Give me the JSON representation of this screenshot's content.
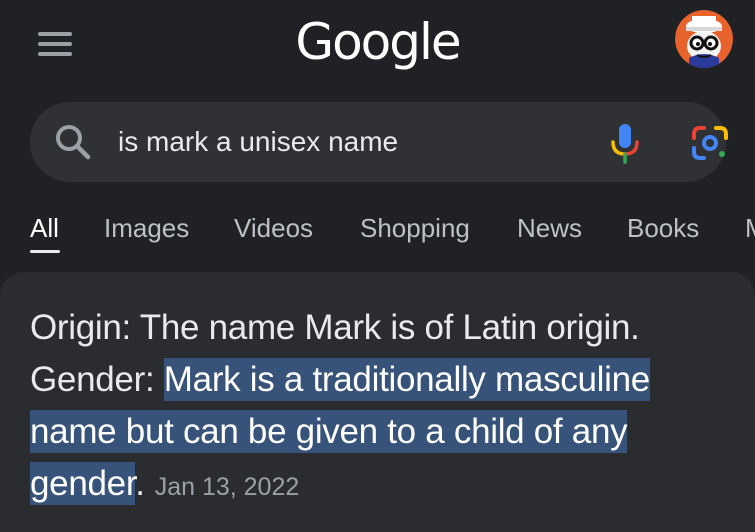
{
  "header": {
    "menu_icon": "hamburger-menu-icon",
    "logo_text": "Google",
    "avatar_icon": "profile-avatar-icon"
  },
  "search": {
    "query": "is mark a unisex name",
    "search_icon": "search-icon",
    "mic_icon": "microphone-icon",
    "lens_icon": "google-lens-icon",
    "colors": {
      "mic_blue": "#4285f4",
      "mic_red": "#ea4335",
      "mic_yellow": "#fbbc04",
      "mic_green": "#34a853"
    }
  },
  "tabs": [
    {
      "label": "All",
      "active": true
    },
    {
      "label": "Images",
      "active": false
    },
    {
      "label": "Videos",
      "active": false
    },
    {
      "label": "Shopping",
      "active": false
    },
    {
      "label": "News",
      "active": false
    },
    {
      "label": "Books",
      "active": false
    },
    {
      "label": "M",
      "active": false
    }
  ],
  "result": {
    "origin_text": "Origin: The name Mark is of Latin origin.",
    "gender_prefix": "Gender: ",
    "highlight_text": "Mark is a traditionally masculine name but can be given to a child of any gender",
    "period": ".",
    "date": "Jan 13, 2022",
    "highlight_color": "#38537a"
  }
}
